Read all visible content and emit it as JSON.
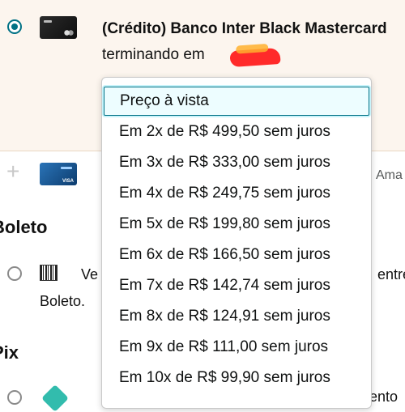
{
  "selected_card": {
    "title": "(Crédito)  Banco Inter Black Mastercard",
    "subtitle": "terminando em"
  },
  "second_card": {
    "partial_label": "Ama"
  },
  "sections": {
    "boleto_heading": "Boleto",
    "boleto_option_partial": "Ve",
    "boleto_option_right_partial": "entre",
    "boleto_option_line2": "Boleto.",
    "pix_heading": "Pix",
    "pix_option_right_partial": "ento"
  },
  "installments_dropdown": {
    "options": [
      "Preço à vista",
      "Em 2x de R$ 499,50 sem juros",
      "Em 3x de R$ 333,00 sem juros",
      "Em 4x de R$ 249,75 sem juros",
      "Em 5x de R$ 199,80 sem juros",
      "Em 6x de R$ 166,50 sem juros",
      "Em 7x de R$ 142,74 sem juros",
      "Em 8x de R$ 124,91 sem juros",
      "Em 9x de R$ 111,00 sem juros",
      "Em 10x de R$ 99,90 sem juros"
    ],
    "highlighted_option": "Preço à vista"
  },
  "colors": {
    "accent": "#007185",
    "selected_row_bg": "#fcf5ee"
  }
}
